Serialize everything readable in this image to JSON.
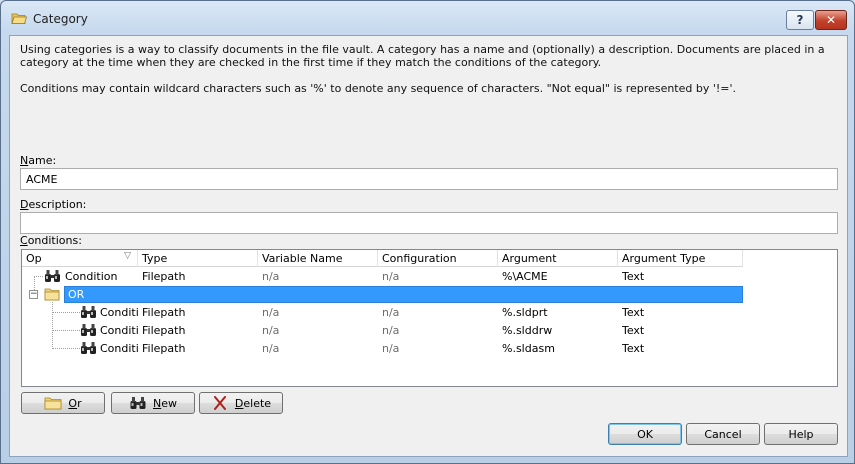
{
  "window": {
    "title": "Category",
    "help_label": "?",
    "close_label": "✕"
  },
  "description": {
    "paragraph1": "Using categories is a way to classify documents in the file vault. A category has a name and (optionally) a description. Documents are placed in a category at the time when they are checked in the first time if they match the conditions of the category.",
    "paragraph2": "Conditions may contain wildcard characters such as '%' to denote any sequence of characters.  \"Not equal\" is represented by '!='."
  },
  "fields": {
    "name_label_hotkey": "N",
    "name_label_rest": "ame:",
    "name_value": "ACME",
    "description_label_hotkey": "D",
    "description_label_rest": "escription:",
    "description_value": "",
    "conditions_label_hotkey": "C",
    "conditions_label_rest": "onditions:"
  },
  "grid": {
    "columns": [
      "Op",
      "Type",
      "Variable Name",
      "Configuration",
      "Argument",
      "Argument Type"
    ],
    "rows": [
      {
        "op": "Condition",
        "type": "Filepath",
        "variable": "n/a",
        "configuration": "n/a",
        "argument": "%\\ACME",
        "argument_type": "Text",
        "level": 0,
        "kind": "condition"
      },
      {
        "op": "OR",
        "type": "",
        "variable": "",
        "configuration": "",
        "argument": "",
        "argument_type": "",
        "level": 0,
        "kind": "group"
      },
      {
        "op": "Conditi...",
        "type": "Filepath",
        "variable": "n/a",
        "configuration": "n/a",
        "argument": "%.sldprt",
        "argument_type": "Text",
        "level": 1,
        "kind": "condition"
      },
      {
        "op": "Conditi...",
        "type": "Filepath",
        "variable": "n/a",
        "configuration": "n/a",
        "argument": "%.slddrw",
        "argument_type": "Text",
        "level": 1,
        "kind": "condition"
      },
      {
        "op": "Conditi...",
        "type": "Filepath",
        "variable": "n/a",
        "configuration": "n/a",
        "argument": "%.sldasm",
        "argument_type": "Text",
        "level": 1,
        "kind": "condition"
      }
    ]
  },
  "buttons": {
    "or_hotkey": "O",
    "or_rest": "r",
    "new_hotkey": "N",
    "new_rest": "ew",
    "delete_hotkey": "D",
    "delete_rest": "elete",
    "ok": "OK",
    "cancel": "Cancel",
    "help": "Help"
  },
  "colors": {
    "selection": "#3399ff",
    "accent": "#3c7fb1"
  }
}
